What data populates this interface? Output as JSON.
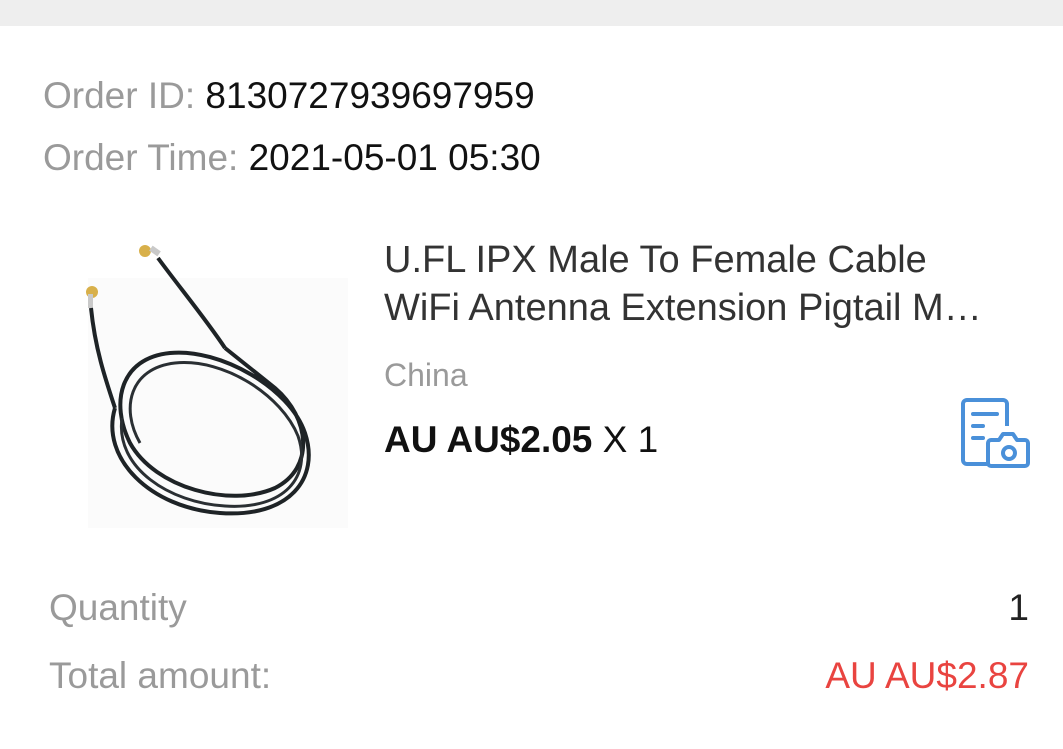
{
  "order": {
    "id_label": "Order ID:",
    "id_value": "8130727939697959",
    "time_label": "Order Time:",
    "time_value": "2021-05-01 05:30"
  },
  "product": {
    "title_line1": "U.FL IPX Male To Female Cable",
    "title_line2": "WiFi Antenna Extension Pigtail M…",
    "origin": "China",
    "price": "AU AU$2.05",
    "quantity_text": "X 1",
    "image_icon": "antenna-cable-image",
    "action_icon": "document-camera-icon"
  },
  "summary": {
    "quantity_label": "Quantity",
    "quantity_value": "1",
    "total_label": "Total amount:",
    "total_value": "AU AU$2.87"
  },
  "colors": {
    "accent_blue": "#4a90d9",
    "total_red": "#e94440",
    "label_gray": "#9a9a9a"
  }
}
